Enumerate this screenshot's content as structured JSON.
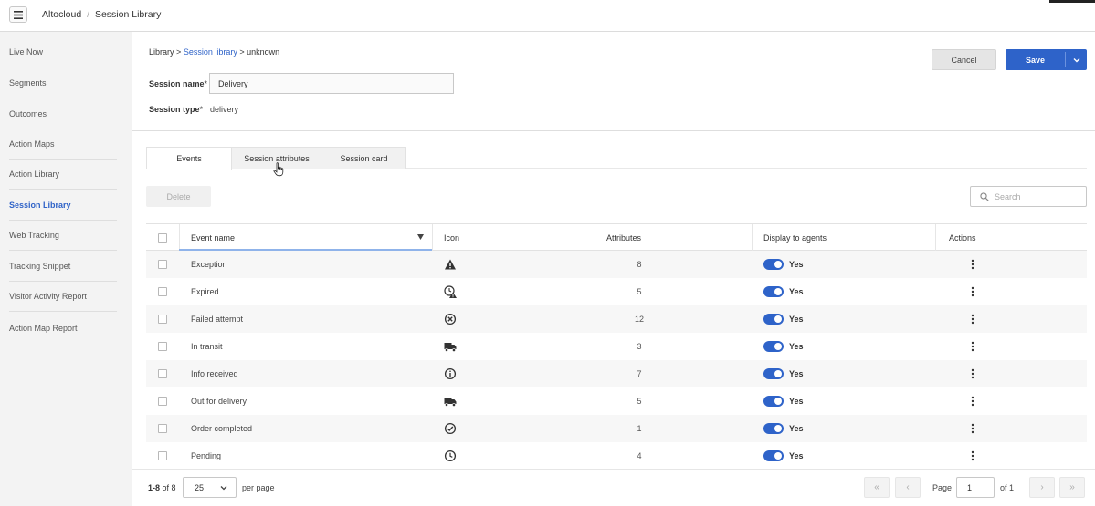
{
  "topbar": {
    "app_name": "Altocloud",
    "separator": "/",
    "page_name": "Session Library"
  },
  "sidebar": {
    "items": [
      {
        "label": "Live Now",
        "active": false
      },
      {
        "label": "Segments",
        "active": false
      },
      {
        "label": "Outcomes",
        "active": false
      },
      {
        "label": "Action Maps",
        "active": false
      },
      {
        "label": "Action Library",
        "active": false
      },
      {
        "label": "Session Library",
        "active": true
      },
      {
        "label": "Web Tracking",
        "active": false
      },
      {
        "label": "Tracking Snippet",
        "active": false
      },
      {
        "label": "Visitor Activity Report",
        "active": false
      },
      {
        "label": "Action Map Report",
        "active": false
      }
    ]
  },
  "breadcrumb": {
    "root": "Library",
    "sep1": ">",
    "link": "Session library",
    "sep2": ">",
    "current": "unknown"
  },
  "actions": {
    "cancel_label": "Cancel",
    "save_label": "Save"
  },
  "form": {
    "session_name_label": "Session name",
    "session_name_value": "Delivery",
    "session_type_label": "Session type",
    "session_type_value": "delivery",
    "required_mark": "*"
  },
  "tabs": [
    {
      "label": "Events",
      "active": true
    },
    {
      "label": "Session attributes",
      "active": false
    },
    {
      "label": "Session card",
      "active": false
    }
  ],
  "toolbar": {
    "delete_label": "Delete",
    "search_placeholder": "Search"
  },
  "table": {
    "columns": {
      "event_name": "Event name",
      "icon": "Icon",
      "attributes": "Attributes",
      "display": "Display to agents",
      "actions": "Actions"
    },
    "rows": [
      {
        "name": "Exception",
        "icon": "warning-icon",
        "attributes": "8",
        "display": "Yes"
      },
      {
        "name": "Expired",
        "icon": "clock-warning-icon",
        "attributes": "5",
        "display": "Yes"
      },
      {
        "name": "Failed attempt",
        "icon": "circle-x-icon",
        "attributes": "12",
        "display": "Yes"
      },
      {
        "name": "In transit",
        "icon": "truck-icon",
        "attributes": "3",
        "display": "Yes"
      },
      {
        "name": "Info received",
        "icon": "info-icon",
        "attributes": "7",
        "display": "Yes"
      },
      {
        "name": "Out for delivery",
        "icon": "truck-icon",
        "attributes": "5",
        "display": "Yes"
      },
      {
        "name": "Order completed",
        "icon": "check-circle-icon",
        "attributes": "1",
        "display": "Yes"
      },
      {
        "name": "Pending",
        "icon": "clock-icon",
        "attributes": "4",
        "display": "Yes"
      }
    ]
  },
  "pagination": {
    "range_bold": "1-8",
    "range_rest": "of 8",
    "per_page_value": "25",
    "per_page_label": "per page",
    "page_label": "Page",
    "page_value": "1",
    "of_label": "of 1",
    "first_glyph": "«",
    "prev_glyph": "‹",
    "next_glyph": "›",
    "last_glyph": "»"
  },
  "colors": {
    "accent": "#2e63c9",
    "link": "#2f63c8",
    "sort_underline": "#8fb3ea"
  }
}
